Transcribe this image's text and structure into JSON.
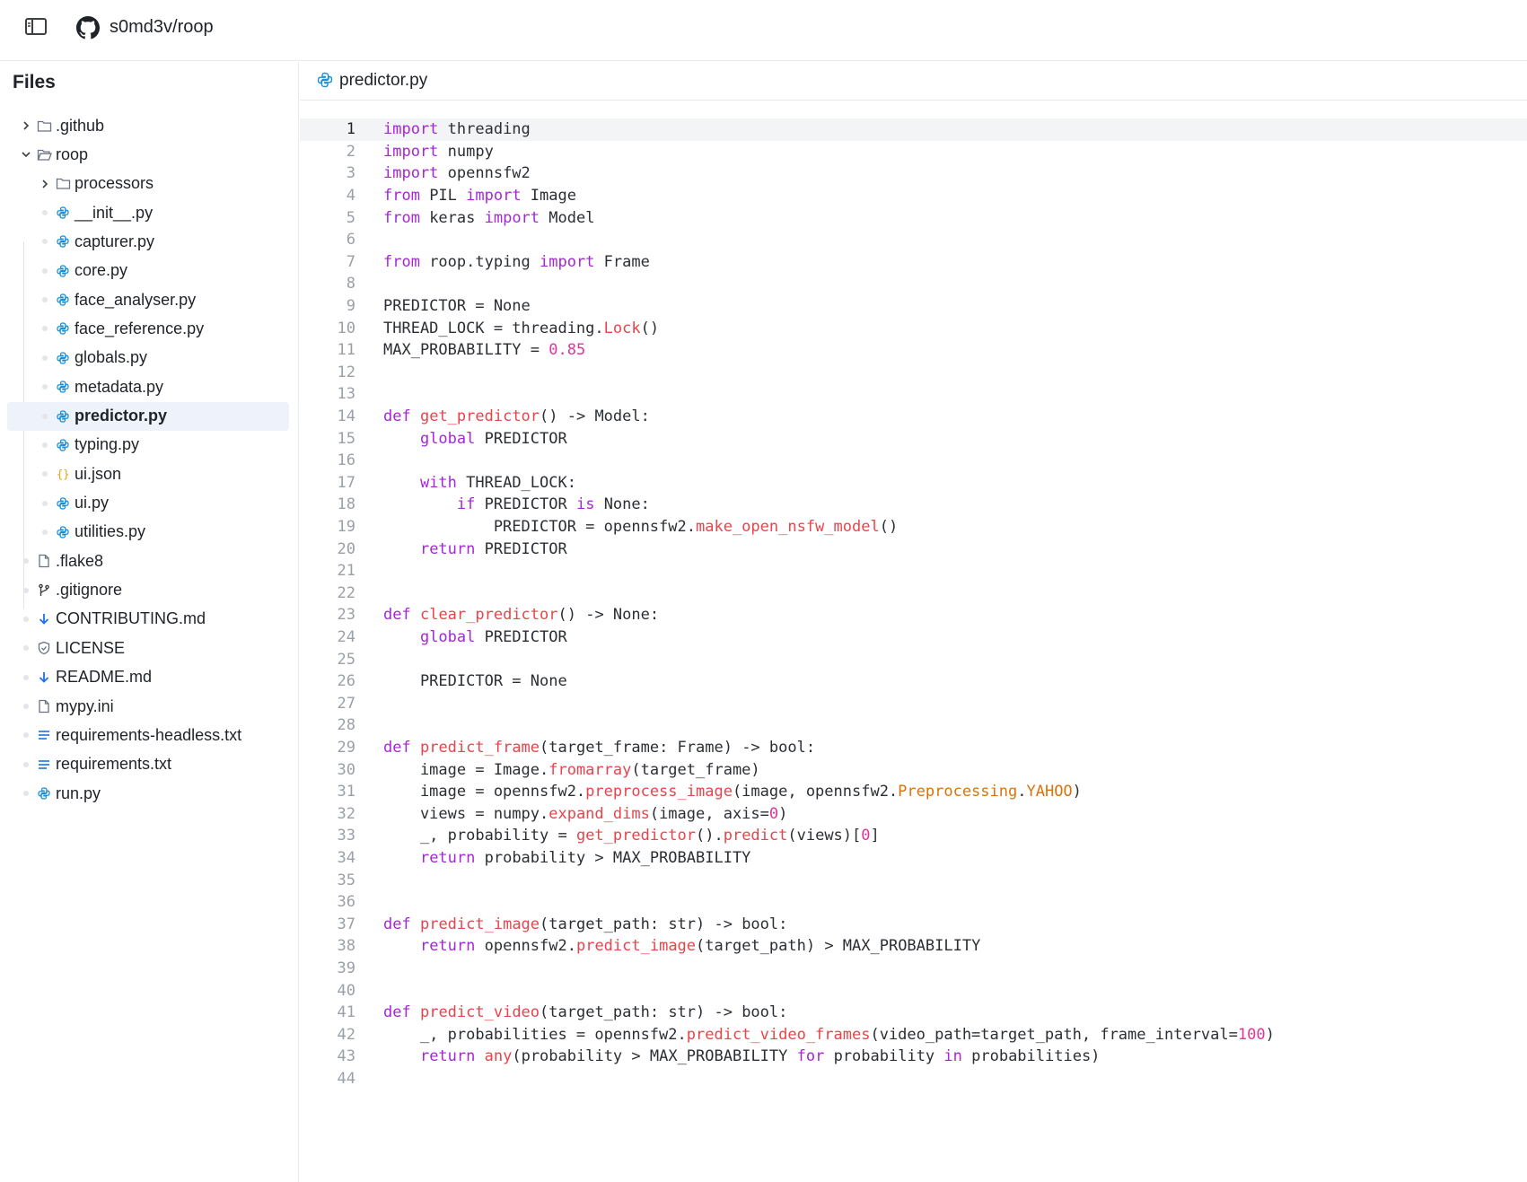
{
  "header": {
    "repo": "s0md3v/roop"
  },
  "sidebar": {
    "title": "Files",
    "items": [
      {
        "label": ".github",
        "kind": "folder-closed",
        "depth": 0
      },
      {
        "label": "roop",
        "kind": "folder-open",
        "depth": 0
      },
      {
        "label": "processors",
        "kind": "folder-closed",
        "depth": 1
      },
      {
        "label": "__init__.py",
        "kind": "python",
        "depth": 1
      },
      {
        "label": "capturer.py",
        "kind": "python",
        "depth": 1
      },
      {
        "label": "core.py",
        "kind": "python",
        "depth": 1
      },
      {
        "label": "face_analyser.py",
        "kind": "python",
        "depth": 1
      },
      {
        "label": "face_reference.py",
        "kind": "python",
        "depth": 1
      },
      {
        "label": "globals.py",
        "kind": "python",
        "depth": 1
      },
      {
        "label": "metadata.py",
        "kind": "python",
        "depth": 1
      },
      {
        "label": "predictor.py",
        "kind": "python",
        "depth": 1,
        "active": true
      },
      {
        "label": "typing.py",
        "kind": "python",
        "depth": 1
      },
      {
        "label": "ui.json",
        "kind": "json",
        "depth": 1
      },
      {
        "label": "ui.py",
        "kind": "python",
        "depth": 1
      },
      {
        "label": "utilities.py",
        "kind": "python",
        "depth": 1
      },
      {
        "label": ".flake8",
        "kind": "file",
        "depth": 0
      },
      {
        "label": ".gitignore",
        "kind": "git",
        "depth": 0
      },
      {
        "label": "CONTRIBUTING.md",
        "kind": "markdown",
        "depth": 0
      },
      {
        "label": "LICENSE",
        "kind": "license",
        "depth": 0
      },
      {
        "label": "README.md",
        "kind": "markdown",
        "depth": 0
      },
      {
        "label": "mypy.ini",
        "kind": "file",
        "depth": 0
      },
      {
        "label": "requirements-headless.txt",
        "kind": "text",
        "depth": 0
      },
      {
        "label": "requirements.txt",
        "kind": "text",
        "depth": 0
      },
      {
        "label": "run.py",
        "kind": "python",
        "depth": 0
      }
    ]
  },
  "editor": {
    "tab_label": "predictor.py",
    "current_line": 1,
    "lines": [
      [
        [
          "kw",
          "import"
        ],
        [
          "t",
          " threading"
        ]
      ],
      [
        [
          "kw",
          "import"
        ],
        [
          "t",
          " numpy"
        ]
      ],
      [
        [
          "kw",
          "import"
        ],
        [
          "t",
          " opennsfw2"
        ]
      ],
      [
        [
          "kw",
          "from"
        ],
        [
          "t",
          " PIL "
        ],
        [
          "kw",
          "import"
        ],
        [
          "t",
          " Image"
        ]
      ],
      [
        [
          "kw",
          "from"
        ],
        [
          "t",
          " keras "
        ],
        [
          "kw",
          "import"
        ],
        [
          "t",
          " Model"
        ]
      ],
      [],
      [
        [
          "kw",
          "from"
        ],
        [
          "t",
          " roop.typing "
        ],
        [
          "kw",
          "import"
        ],
        [
          "t",
          " Frame"
        ]
      ],
      [],
      [
        [
          "t",
          "PREDICTOR = None"
        ]
      ],
      [
        [
          "t",
          "THREAD_LOCK = threading."
        ],
        [
          "fn",
          "Lock"
        ],
        [
          "t",
          "()"
        ]
      ],
      [
        [
          "t",
          "MAX_PROBABILITY = "
        ],
        [
          "num",
          "0.85"
        ]
      ],
      [],
      [],
      [
        [
          "kw",
          "def"
        ],
        [
          "t",
          " "
        ],
        [
          "fn",
          "get_predictor"
        ],
        [
          "t",
          "() -> Model:"
        ]
      ],
      [
        [
          "t",
          "    "
        ],
        [
          "kw",
          "global"
        ],
        [
          "t",
          " PREDICTOR"
        ]
      ],
      [],
      [
        [
          "t",
          "    "
        ],
        [
          "kw",
          "with"
        ],
        [
          "t",
          " THREAD_LOCK:"
        ]
      ],
      [
        [
          "t",
          "        "
        ],
        [
          "kw",
          "if"
        ],
        [
          "t",
          " PREDICTOR "
        ],
        [
          "kw",
          "is"
        ],
        [
          "t",
          " None:"
        ]
      ],
      [
        [
          "t",
          "            PREDICTOR = opennsfw2."
        ],
        [
          "fn",
          "make_open_nsfw_model"
        ],
        [
          "t",
          "()"
        ]
      ],
      [
        [
          "t",
          "    "
        ],
        [
          "kw",
          "return"
        ],
        [
          "t",
          " PREDICTOR"
        ]
      ],
      [],
      [],
      [
        [
          "kw",
          "def"
        ],
        [
          "t",
          " "
        ],
        [
          "fn",
          "clear_predictor"
        ],
        [
          "t",
          "() -> None:"
        ]
      ],
      [
        [
          "t",
          "    "
        ],
        [
          "kw",
          "global"
        ],
        [
          "t",
          " PREDICTOR"
        ]
      ],
      [],
      [
        [
          "t",
          "    PREDICTOR = None"
        ]
      ],
      [],
      [],
      [
        [
          "kw",
          "def"
        ],
        [
          "t",
          " "
        ],
        [
          "fn",
          "predict_frame"
        ],
        [
          "t",
          "(target_frame: Frame) -> bool:"
        ]
      ],
      [
        [
          "t",
          "    image = Image."
        ],
        [
          "fn",
          "fromarray"
        ],
        [
          "t",
          "(target_frame)"
        ]
      ],
      [
        [
          "t",
          "    image = opennsfw2."
        ],
        [
          "fn",
          "preprocess_image"
        ],
        [
          "t",
          "(image, opennsfw2."
        ],
        [
          "cls",
          "Preprocessing"
        ],
        [
          "t",
          "."
        ],
        [
          "cls",
          "YAHOO"
        ],
        [
          "t",
          ")"
        ]
      ],
      [
        [
          "t",
          "    views = numpy."
        ],
        [
          "fn",
          "expand_dims"
        ],
        [
          "t",
          "(image, axis="
        ],
        [
          "num",
          "0"
        ],
        [
          "t",
          ")"
        ]
      ],
      [
        [
          "t",
          "    _, probability = "
        ],
        [
          "fn",
          "get_predictor"
        ],
        [
          "t",
          "()."
        ],
        [
          "fn",
          "predict"
        ],
        [
          "t",
          "(views)["
        ],
        [
          "num",
          "0"
        ],
        [
          "t",
          "]"
        ]
      ],
      [
        [
          "t",
          "    "
        ],
        [
          "kw",
          "return"
        ],
        [
          "t",
          " probability > MAX_PROBABILITY"
        ]
      ],
      [],
      [],
      [
        [
          "kw",
          "def"
        ],
        [
          "t",
          " "
        ],
        [
          "fn",
          "predict_image"
        ],
        [
          "t",
          "(target_path: str) -> bool:"
        ]
      ],
      [
        [
          "t",
          "    "
        ],
        [
          "kw",
          "return"
        ],
        [
          "t",
          " opennsfw2."
        ],
        [
          "fn",
          "predict_image"
        ],
        [
          "t",
          "(target_path) > MAX_PROBABILITY"
        ]
      ],
      [],
      [],
      [
        [
          "kw",
          "def"
        ],
        [
          "t",
          " "
        ],
        [
          "fn",
          "predict_video"
        ],
        [
          "t",
          "(target_path: str) -> bool:"
        ]
      ],
      [
        [
          "t",
          "    _, probabilities = opennsfw2."
        ],
        [
          "fn",
          "predict_video_frames"
        ],
        [
          "t",
          "(video_path=target_path, frame_interval="
        ],
        [
          "num",
          "100"
        ],
        [
          "t",
          ")"
        ]
      ],
      [
        [
          "t",
          "    "
        ],
        [
          "kw",
          "return"
        ],
        [
          "t",
          " "
        ],
        [
          "fn",
          "any"
        ],
        [
          "t",
          "(probability > MAX_PROBABILITY "
        ],
        [
          "kw",
          "for"
        ],
        [
          "t",
          " probability "
        ],
        [
          "kw",
          "in"
        ],
        [
          "t",
          " probabilities)"
        ]
      ],
      []
    ]
  }
}
